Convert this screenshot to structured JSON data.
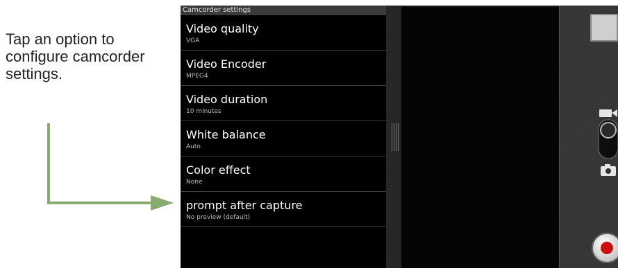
{
  "caption": "Tap an option to configure camcorder settings.",
  "settings": {
    "header": "Camcorder settings",
    "items": [
      {
        "title": "Video quality",
        "value": "VGA"
      },
      {
        "title": "Video Encoder",
        "value": "MPEG4"
      },
      {
        "title": "Video duration",
        "value": "10 minutes"
      },
      {
        "title": "White balance",
        "value": "Auto"
      },
      {
        "title": "Color effect",
        "value": "None"
      },
      {
        "title": "prompt after capture",
        "value": "No preview (default)"
      }
    ]
  },
  "controls": {
    "thumbnail_icon": "thumbnail-icon",
    "video_icon": "video-camera-icon",
    "photo_icon": "camera-icon",
    "mode_toggle": "mode-toggle",
    "shutter_icon": "record-icon"
  },
  "colors": {
    "arrow": "#8aab6f",
    "record": "#cc1010",
    "panel_bg": "#000000",
    "header_bg": "#3a3a3a"
  }
}
